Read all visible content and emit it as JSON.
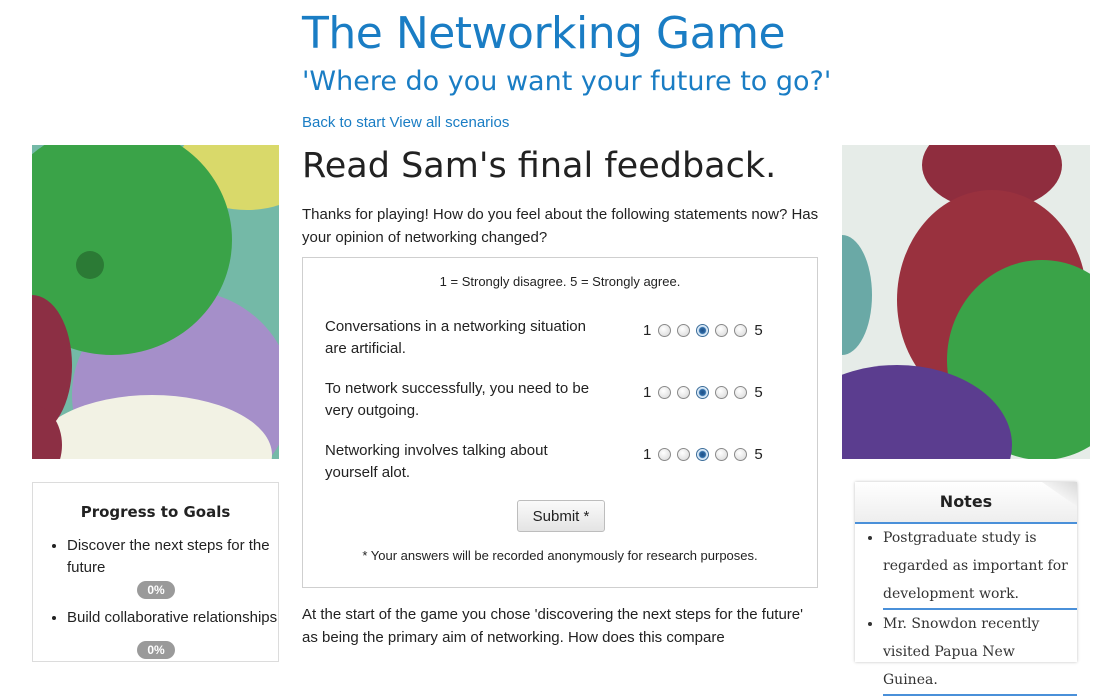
{
  "header": {
    "title": "The Networking Game",
    "subtitle": "'Where do you want your future to go?'",
    "links": [
      "Back to start",
      "View all scenarios"
    ]
  },
  "main": {
    "heading": "Read Sam's final feedback.",
    "intro": "Thanks for playing! How do you feel about the following statements now? Has your opinion of networking changed?",
    "survey": {
      "scale_note": "1 = Strongly disagree. 5 = Strongly agree.",
      "scale_min_label": "1",
      "scale_max_label": "5",
      "questions": [
        {
          "text": "Conversations in a networking situation are artificial.",
          "selected": 3
        },
        {
          "text": "To network successfully, you need to be very outgoing.",
          "selected": 3
        },
        {
          "text": "Networking involves talking about yourself alot.",
          "selected": 3
        }
      ],
      "submit_label": "Submit *",
      "footnote": "* Your answers will be recorded anonymously for research purposes."
    },
    "after_text": "At the start of the game you chose 'discovering the next steps for the future' as being the primary aim of networking. How does this compare"
  },
  "progress": {
    "title": "Progress to Goals",
    "goals": [
      {
        "label": "Discover the next steps for the future",
        "percent": "0%"
      },
      {
        "label": "Build collaborative relationships",
        "percent": "0%"
      }
    ]
  },
  "notes": {
    "title": "Notes",
    "items": [
      "Postgraduate study is regarded as important for development work.",
      "Mr. Snowdon recently visited Papua New Guinea."
    ]
  },
  "colors": {
    "brand_blue": "#1a7dc4",
    "note_rule": "#4a90d9",
    "badge_grey": "#9a9a9a"
  }
}
